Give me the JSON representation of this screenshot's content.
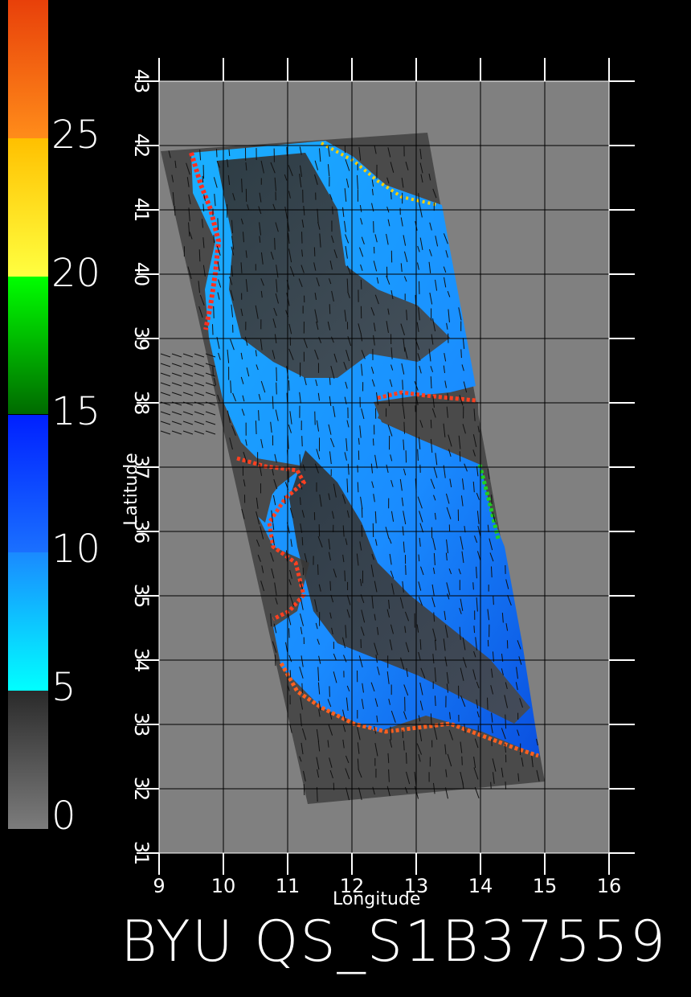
{
  "colorbar": {
    "labels": [
      "25",
      "20",
      "15",
      "10",
      "5",
      "0"
    ],
    "segments": [
      {
        "from": 25,
        "to": 30,
        "top": "#e8400a",
        "bottom": "#ff8c1a"
      },
      {
        "from": 20,
        "to": 25,
        "top": "#ffc000",
        "bottom": "#ffff40"
      },
      {
        "from": 15,
        "to": 20,
        "top": "#00ff00",
        "bottom": "#006a00"
      },
      {
        "from": 10,
        "to": 15,
        "top": "#0020ff",
        "bottom": "#1a70ff"
      },
      {
        "from": 5,
        "to": 10,
        "top": "#1a8aff",
        "bottom": "#00ffff"
      },
      {
        "from": 0,
        "to": 5,
        "top": "#2a2a2a",
        "bottom": "#7c7c7c"
      }
    ]
  },
  "map": {
    "lat_ticks": [
      "31",
      "32",
      "33",
      "34",
      "35",
      "36",
      "37",
      "38",
      "39",
      "40",
      "41",
      "42",
      "43"
    ],
    "lon_ticks": [
      "9",
      "10",
      "11",
      "12",
      "13",
      "14",
      "15",
      "16"
    ],
    "xlabel": "Longitude",
    "ylabel": "Latitude",
    "background_color": "#808080",
    "swath_color": "#4a4a4a"
  },
  "title": "BYU  QS_S1B37559"
}
